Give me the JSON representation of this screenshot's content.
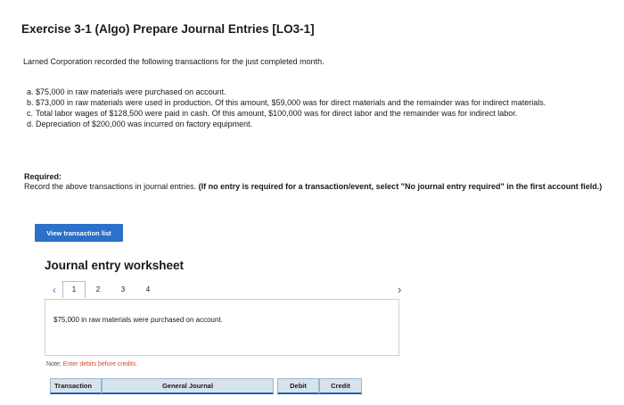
{
  "title": "Exercise 3-1 (Algo) Prepare Journal Entries [LO3-1]",
  "intro": "Larned Corporation recorded the following transactions for the just completed month.",
  "items": [
    {
      "letter": "a.",
      "text": "$75,000 in raw materials were purchased on account."
    },
    {
      "letter": "b.",
      "text": "$73,000 in raw materials were used in production. Of this amount, $59,000 was for direct materials and the remainder was for indirect materials."
    },
    {
      "letter": "c.",
      "text": "Total labor wages of $128,500 were paid in cash. Of this amount, $100,000 was for direct labor and the remainder was for indirect labor."
    },
    {
      "letter": "d.",
      "text": "Depreciation of $200,000 was incurred on factory equipment."
    }
  ],
  "required": {
    "heading": "Required:",
    "text": "Record the above transactions in journal entries.",
    "instruction": "(If no entry is required for a transaction/event, select \"No journal entry required\" in the first account field.)"
  },
  "view_button": "View transaction list",
  "worksheet": {
    "title": "Journal entry worksheet",
    "pages": [
      "1",
      "2",
      "3",
      "4"
    ],
    "description": "$75,000 in raw materials were purchased on account.",
    "note_label": "Note:",
    "note_text": "Enter debits before credits.",
    "columns": {
      "transaction": "Transaction",
      "general_journal": "General Journal",
      "debit": "Debit",
      "credit": "Credit"
    }
  }
}
